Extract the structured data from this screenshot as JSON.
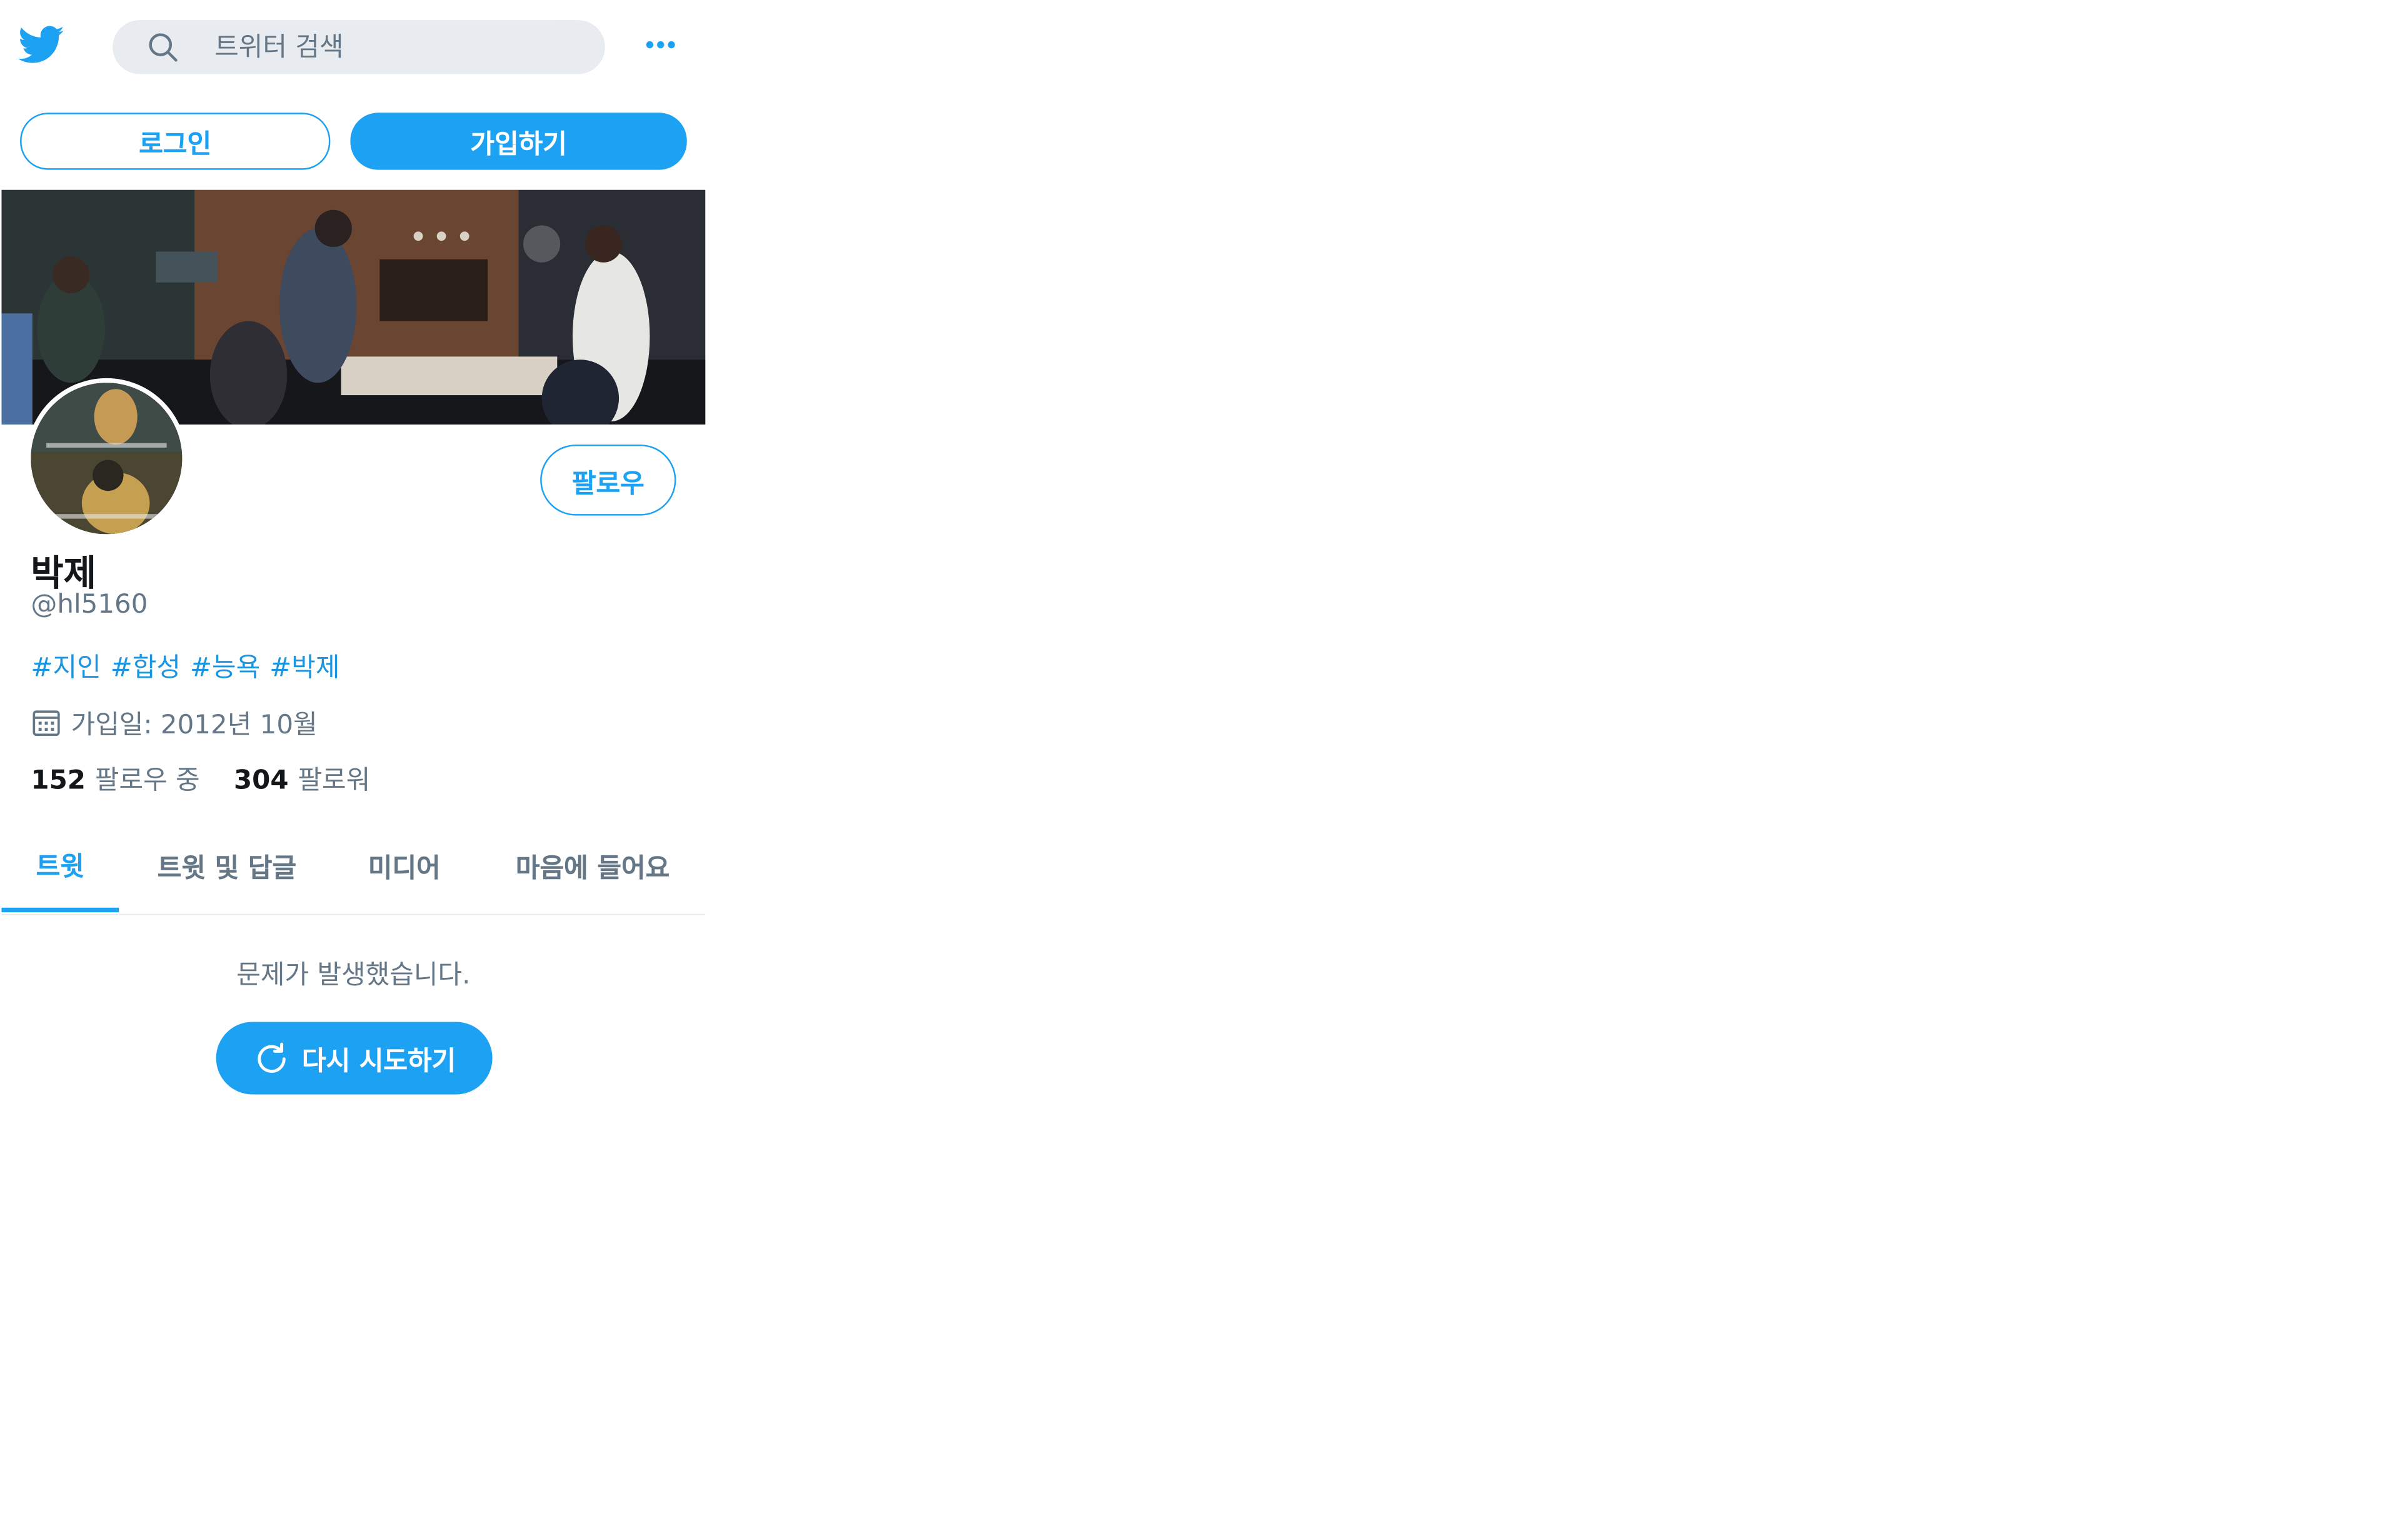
{
  "search": {
    "placeholder": "트위터 검색"
  },
  "auth": {
    "login_label": "로그인",
    "signup_label": "가입하기"
  },
  "profile": {
    "name": "박제",
    "handle": "@hl5160",
    "bio_tags": [
      "#지인",
      "#합성",
      "#능욕",
      "#박제"
    ],
    "joined": "가입일: 2012년 10월",
    "following_count": "152",
    "following_label": "팔로우 중",
    "followers_count": "304",
    "followers_label": "팔로워",
    "follow_label": "팔로우"
  },
  "tabs": [
    {
      "label": "트윗",
      "active": true
    },
    {
      "label": "트윗 및 답글",
      "active": false
    },
    {
      "label": "미디어",
      "active": false
    },
    {
      "label": "마음에 들어요",
      "active": false
    }
  ],
  "error": {
    "message": "문제가 발생했습니다.",
    "retry_label": "다시 시도하기"
  },
  "colors": {
    "accent": "#1da1f2",
    "muted": "#657786",
    "text": "#14171a",
    "search_bg": "#e8ecf0"
  },
  "icons": {
    "logo": "twitter-bird-icon",
    "search": "search-icon",
    "more": "more-dots-icon",
    "calendar": "calendar-icon",
    "retry": "refresh-icon"
  }
}
